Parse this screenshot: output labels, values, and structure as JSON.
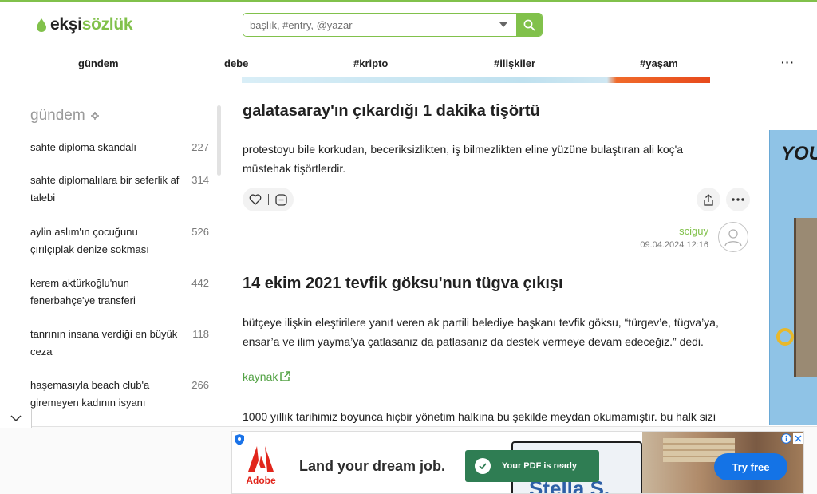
{
  "brand": {
    "logo_dark": "ekşi",
    "logo_green": "sözlük",
    "accent": "#81c14b"
  },
  "search": {
    "placeholder": "başlık, #entry, @yazar"
  },
  "topnav": {
    "items": [
      {
        "label": "gündem"
      },
      {
        "label": "debe"
      },
      {
        "label": "#kripto"
      },
      {
        "label": "#ilişkiler"
      },
      {
        "label": "#yaşam"
      }
    ],
    "more": "···"
  },
  "sidebar": {
    "title": "gündem",
    "topics": [
      {
        "line1": "sahte diploma skandalı",
        "line2": "",
        "count": "227"
      },
      {
        "line1": "sahte diplomalılara bir seferlik af",
        "line2": "talebi",
        "count": "314"
      },
      {
        "line1": "aylin aslım'ın çocuğunu",
        "line2": "çırılçıplak denize sokması",
        "count": "526"
      },
      {
        "line1": "kerem aktürkoğlu'nun",
        "line2": "fenerbahçe'ye transferi",
        "count": "442"
      },
      {
        "line1": "tanrının insana verdiği en büyük",
        "line2": "ceza",
        "count": "118"
      },
      {
        "line1": "haşemasıyla beach club'a",
        "line2": "giremeyen kadının isyanı",
        "count": "266"
      }
    ]
  },
  "entries": [
    {
      "title": "galatasaray'ın çıkardığı 1 dakika tişörtü",
      "line1": "protestoyu bile korkudan, beceriksizlikten, iş bilmezlikten eline yüzüne bulaştıran ali koç'a",
      "line2": "müstehak tişörtlerdir.",
      "author": "sciguy",
      "date": "09.04.2024 12:16"
    },
    {
      "title": "14 ekim 2021 tevfik göksu'nun tügva çıkışı",
      "line1": "bütçeye ilişkin eleştirilere yanıt veren ak partili belediye başkanı tevfik göksu, “türgev’e, tügva’ya,",
      "line2": "ensar’a ve ilim yayma’ya çatlasanız da patlasanız da destek vermeye devam edeceğiz.” dedi.",
      "link": "kaynak",
      "line3": "1000 yıllık tarihimiz boyunca hiçbir yönetim halkına bu şekilde meydan okumamıştır. bu halk sizi"
    }
  ],
  "side_ad": {
    "text": "YOU"
  },
  "bottom_ad": {
    "brand": "Adobe",
    "headline": "Land your dream job.",
    "toast": "Your PDF is ready",
    "preview_text": "Stella S.",
    "cta": "Try free"
  }
}
